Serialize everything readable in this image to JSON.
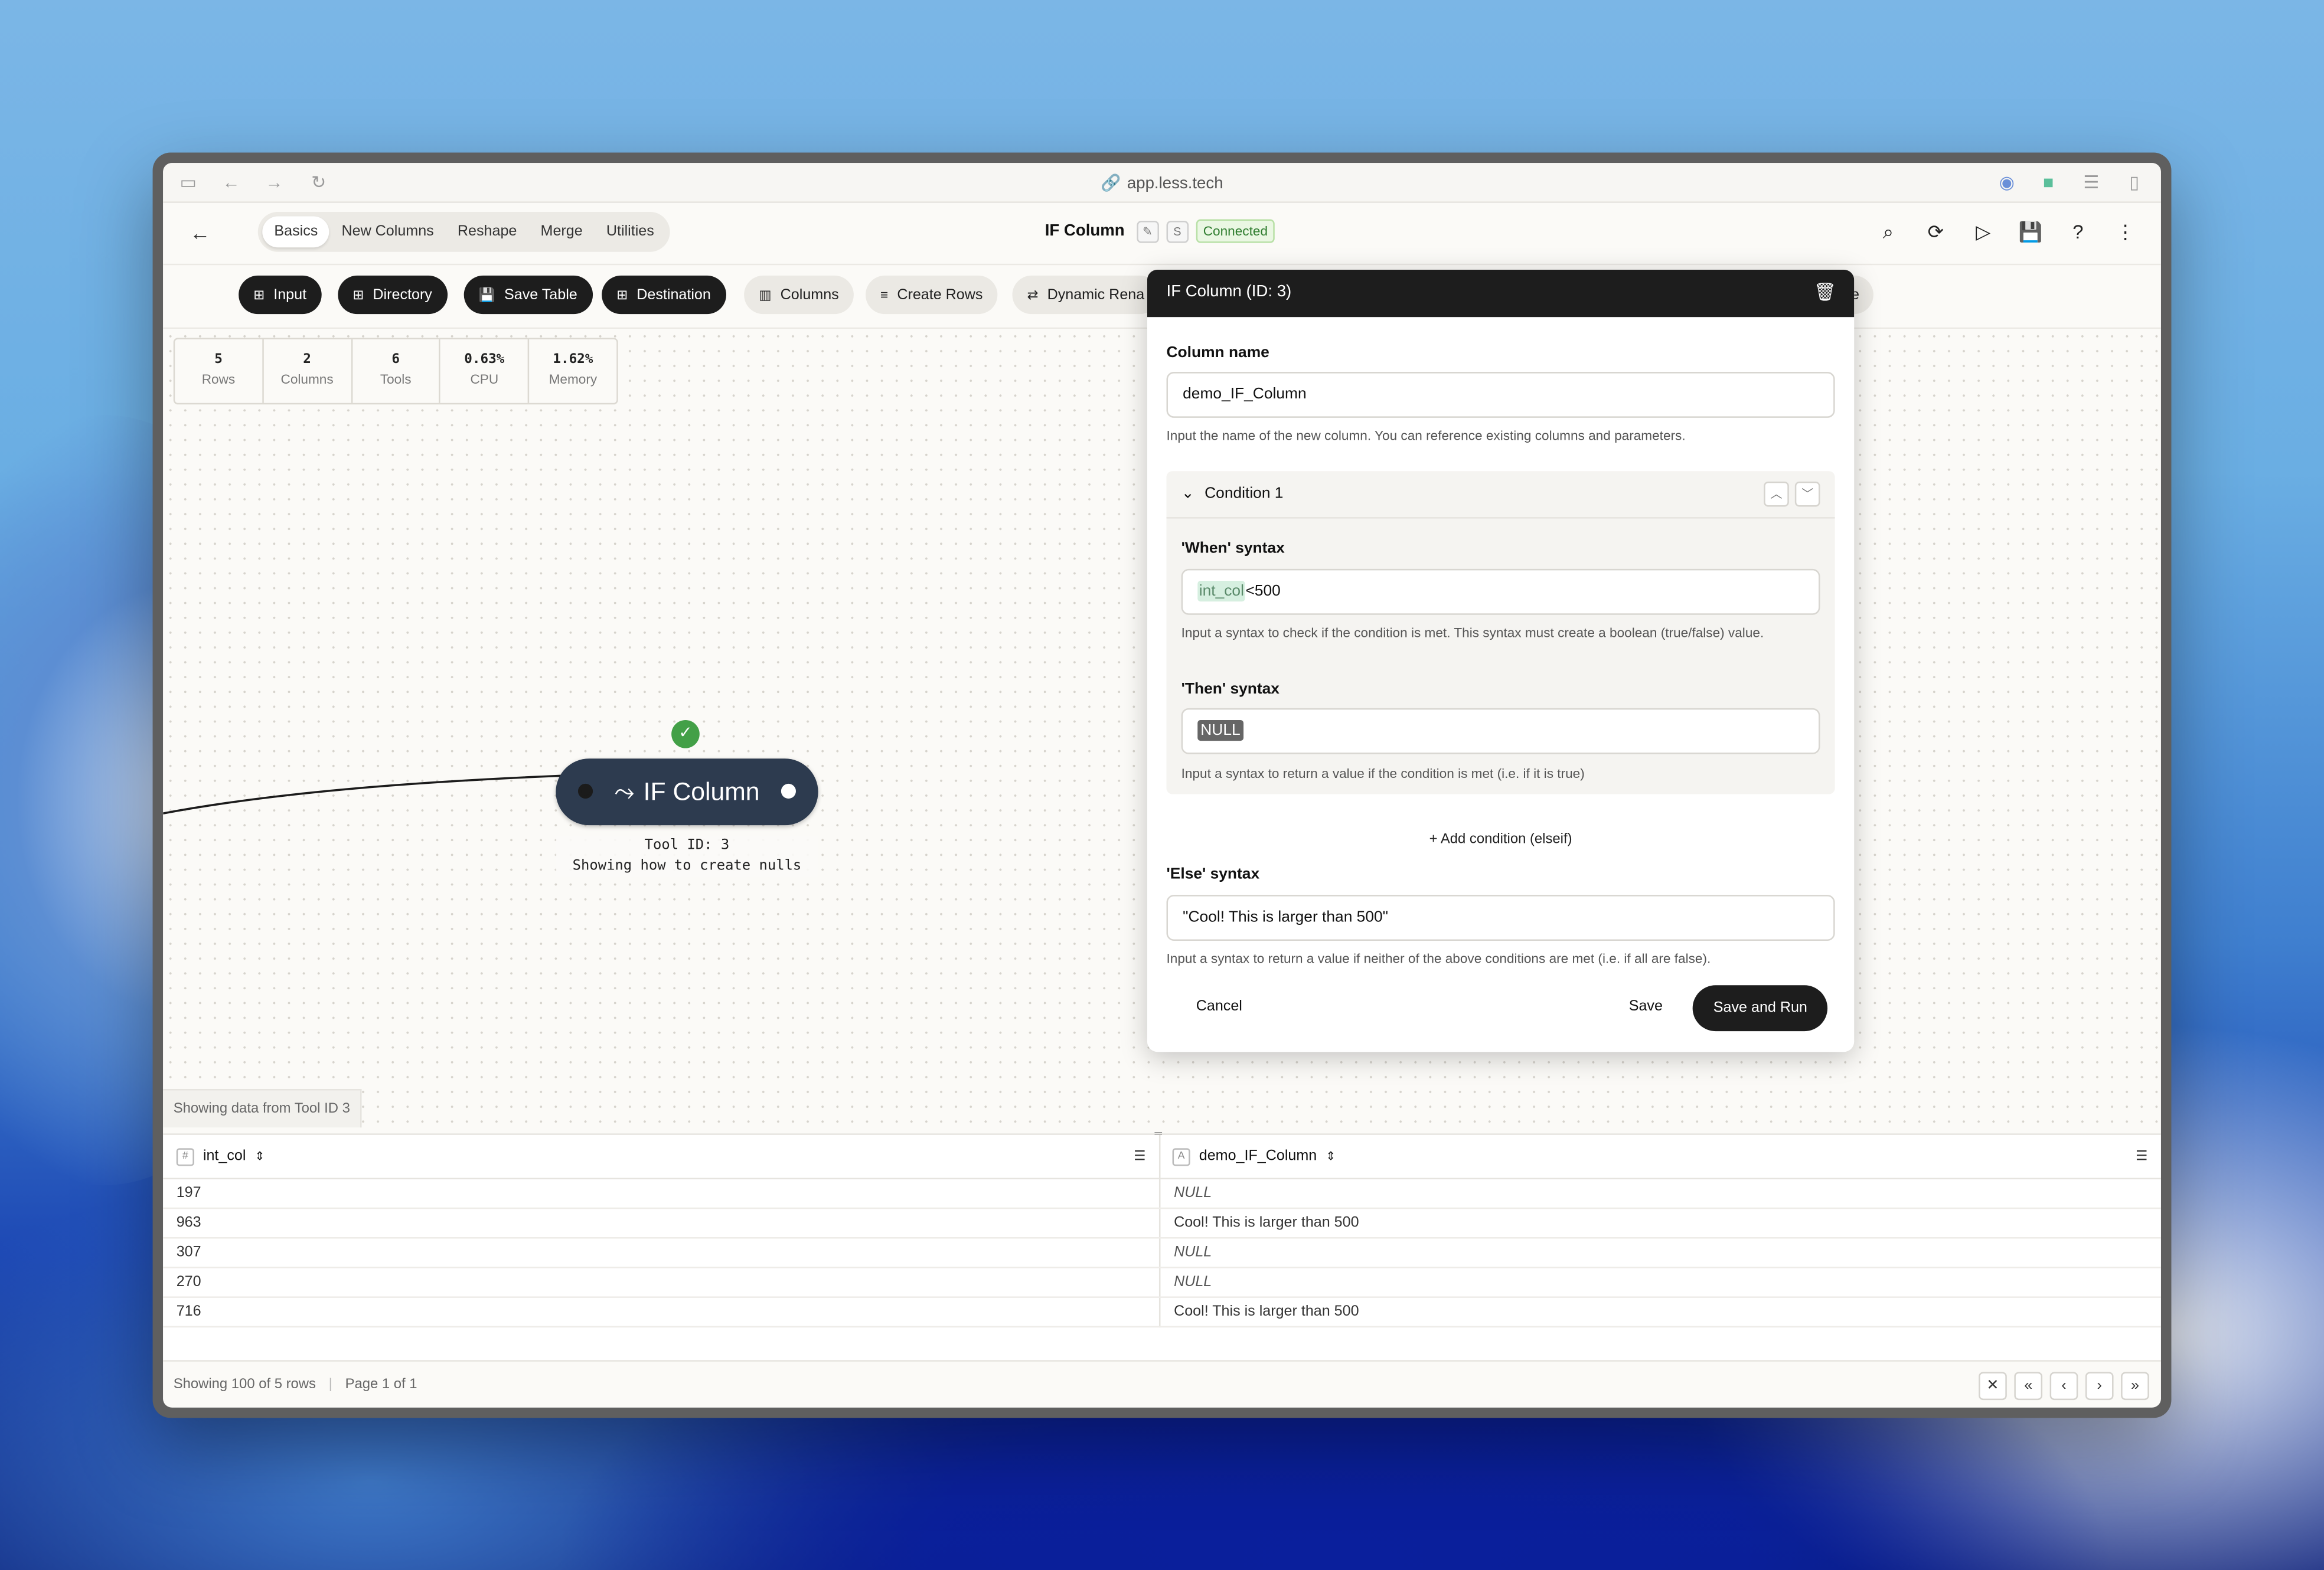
{
  "browser": {
    "url": "app.less.tech"
  },
  "header": {
    "tabs": [
      {
        "label": "Basics",
        "active": true
      },
      {
        "label": "New Columns"
      },
      {
        "label": "Reshape"
      },
      {
        "label": "Merge"
      },
      {
        "label": "Utilities"
      }
    ],
    "title": "IF Column",
    "badge_s": "S",
    "status": "Connected"
  },
  "toolbar": {
    "tools": [
      {
        "label": "Input",
        "style": "dark"
      },
      {
        "label": "Directory",
        "style": "dark"
      },
      {
        "label": "Save Table",
        "style": "dark"
      },
      {
        "label": "Destination",
        "style": "dark"
      },
      {
        "label": "Columns",
        "style": "light"
      },
      {
        "label": "Create Rows",
        "style": "light"
      },
      {
        "label": "Dynamic Rena",
        "style": "light"
      },
      {
        "label": "nique",
        "style": "light"
      }
    ]
  },
  "stats": [
    {
      "value": "5",
      "label": "Rows"
    },
    {
      "value": "2",
      "label": "Columns"
    },
    {
      "value": "6",
      "label": "Tools"
    },
    {
      "value": "0.63%",
      "label": "CPU"
    },
    {
      "value": "1.62%",
      "label": "Memory"
    }
  ],
  "node": {
    "label": "IF Column",
    "caption_line1": "Tool ID: 3",
    "caption_line2": "Showing how to create nulls"
  },
  "canvas": {
    "showing_label": "Showing data from Tool ID 3"
  },
  "dialog": {
    "title": "IF Column (ID: 3)",
    "column_name_label": "Column name",
    "column_name_value": "demo_IF_Column",
    "column_name_help": "Input the name of the new column. You can reference existing columns and parameters.",
    "condition_title": "Condition 1",
    "when_label": "'When' syntax",
    "when_column": "int_col",
    "when_rest": "<500",
    "when_help": "Input a syntax to check if the condition is met. This syntax must create a boolean (true/false) value.",
    "then_label": "'Then' syntax",
    "then_value": "NULL",
    "then_help": "Input a syntax to return a value if the condition is met (i.e. if it is true)",
    "add_condition": "Add condition (elseif)",
    "else_label": "'Else' syntax",
    "else_value": "\"Cool! This is larger than 500\"",
    "else_help": "Input a syntax to return a value if neither of the above conditions are met (i.e. if all are false).",
    "cancel": "Cancel",
    "save": "Save",
    "save_and_run": "Save and Run"
  },
  "table": {
    "columns": [
      "int_col",
      "demo_IF_Column"
    ],
    "rows": [
      [
        "197",
        "NULL"
      ],
      [
        "963",
        "Cool! This is larger than 500"
      ],
      [
        "307",
        "NULL"
      ],
      [
        "270",
        "NULL"
      ],
      [
        "716",
        "Cool! This is larger than 500"
      ]
    ]
  },
  "footer": {
    "rows_info": "Showing 100 of 5 rows",
    "separator": "|",
    "page_info": "Page 1 of 1"
  },
  "colors": {
    "accent_dark": "#1d1d1d",
    "node": "#2d3b4f",
    "success": "#43a047",
    "connected_text": "#2f7d2f"
  }
}
